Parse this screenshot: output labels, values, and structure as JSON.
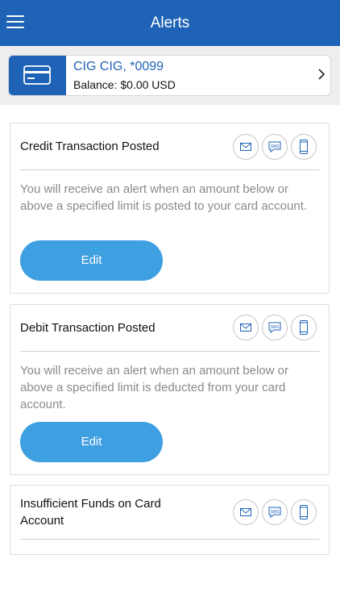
{
  "header": {
    "title": "Alerts",
    "menu_icon": "hamburger-menu-icon",
    "color": "#1f63b6"
  },
  "card": {
    "name": "CIG CIG, *0099",
    "balance": "Balance: $0.00 USD",
    "icon": "credit-card-icon",
    "chevron_icon": "chevron-right-icon"
  },
  "alerts": [
    {
      "title": "Credit Transaction Posted",
      "description": "You will receive an alert when an amount below or above a specified limit is posted to your card account.",
      "edit_label": "Edit"
    },
    {
      "title": "Debit Transaction Posted",
      "description": "You will receive an alert when an amount below or above a specified limit is deducted from your card account.",
      "edit_label": "Edit"
    },
    {
      "title": "Insufficient Funds on Card Account"
    }
  ],
  "channel_icons": [
    "email-icon",
    "sms-icon",
    "mobile-icon"
  ],
  "sms_icon_text": "SMS",
  "colors": {
    "brand": "#1f63b6",
    "button": "#3e9fe1",
    "desc_text": "#8a8a8a"
  }
}
